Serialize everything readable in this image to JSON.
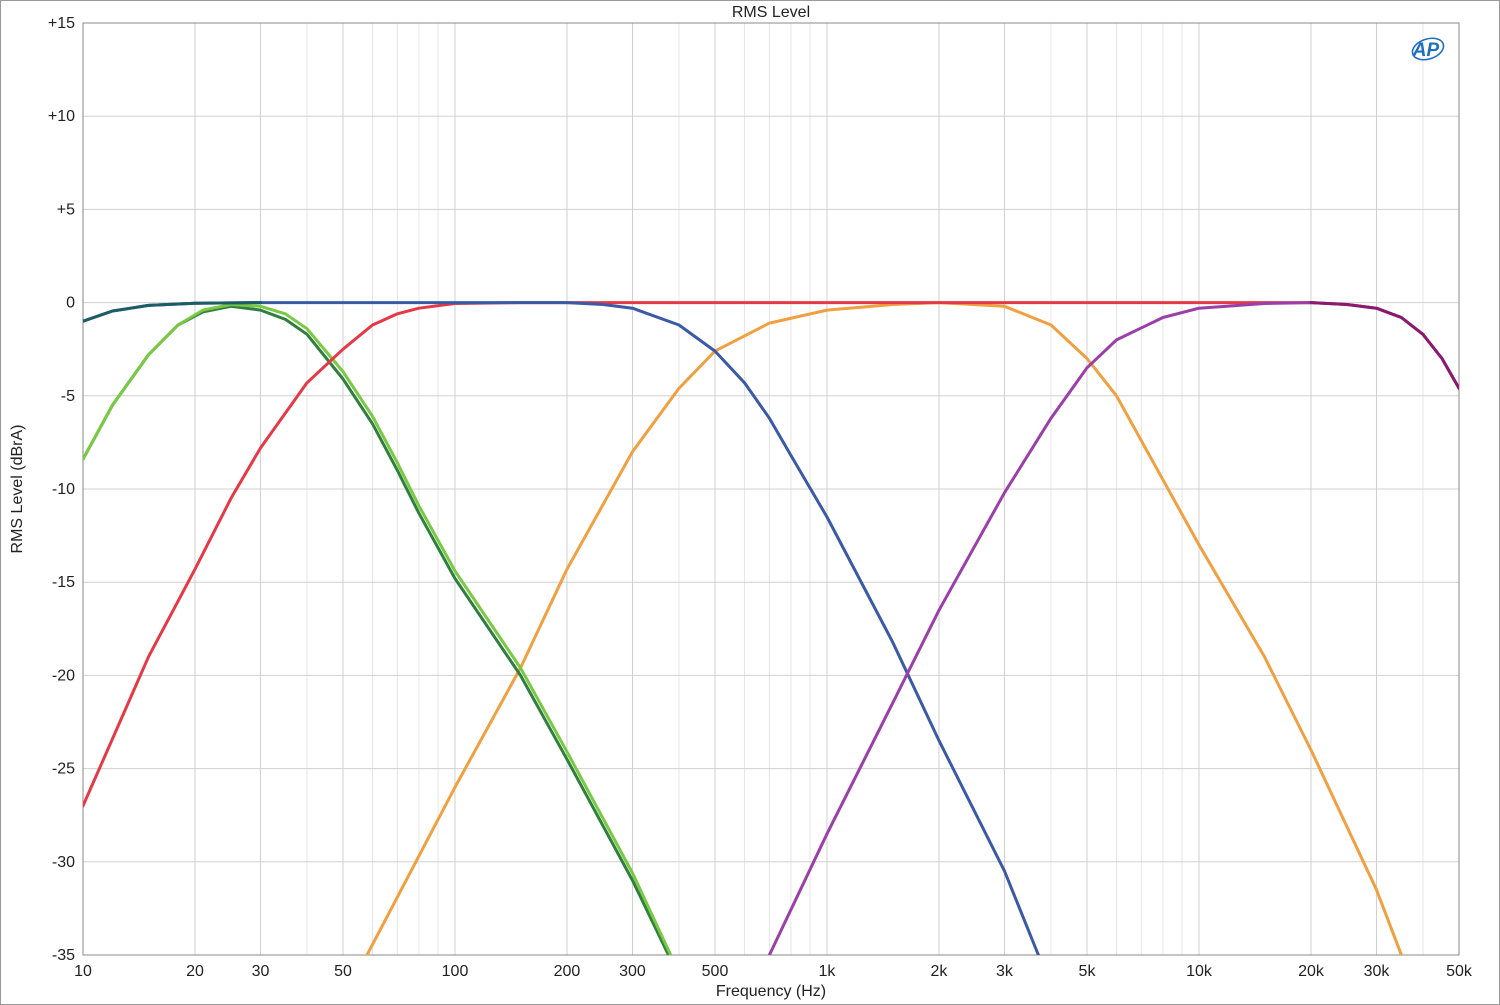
{
  "chart_data": {
    "type": "line",
    "title": "RMS Level",
    "xlabel": "Frequency (Hz)",
    "ylabel": "RMS Level (dBrA)",
    "xscale": "log",
    "xlim": [
      10,
      50000
    ],
    "ylim": [
      -35,
      15
    ],
    "x_ticks": [
      10,
      20,
      30,
      50,
      100,
      200,
      300,
      500,
      1000,
      2000,
      3000,
      5000,
      10000,
      20000,
      30000,
      50000
    ],
    "x_tick_labels": [
      "10",
      "20",
      "30",
      "50",
      "100",
      "200",
      "300",
      "500",
      "1k",
      "2k",
      "3k",
      "5k",
      "10k",
      "20k",
      "30k",
      "50k"
    ],
    "y_ticks": [
      15,
      10,
      5,
      0,
      -5,
      -10,
      -15,
      -20,
      -25,
      -30,
      -35
    ],
    "y_tick_labels": [
      "+15",
      "+10",
      "+5",
      "0",
      "-5",
      "-10",
      "-15",
      "-20",
      "-25",
      "-30",
      "-35"
    ],
    "grid": true,
    "logo": "AP",
    "series": [
      {
        "color": "#f0a040",
        "points": [
          [
            58,
            -35
          ],
          [
            100,
            -26
          ],
          [
            150,
            -19.6
          ],
          [
            200,
            -14.3
          ],
          [
            300,
            -8
          ],
          [
            400,
            -4.6
          ],
          [
            500,
            -2.6
          ],
          [
            700,
            -1.1
          ],
          [
            1000,
            -0.4
          ],
          [
            1500,
            -0.1
          ],
          [
            2000,
            0
          ],
          [
            3000,
            -0.2
          ],
          [
            4000,
            -1.2
          ],
          [
            5000,
            -3
          ],
          [
            6000,
            -5
          ],
          [
            8000,
            -9.5
          ],
          [
            10000,
            -13
          ],
          [
            15000,
            -19
          ],
          [
            20000,
            -24
          ],
          [
            30000,
            -31.5
          ],
          [
            35000,
            -35
          ]
        ]
      },
      {
        "color": "#2f7f3f",
        "points": [
          [
            10,
            -8.4
          ],
          [
            12,
            -5.5
          ],
          [
            15,
            -2.8
          ],
          [
            18,
            -1.2
          ],
          [
            21,
            -0.5
          ],
          [
            25,
            -0.2
          ],
          [
            30,
            -0.4
          ],
          [
            35,
            -0.9
          ],
          [
            40,
            -1.7
          ],
          [
            50,
            -4.1
          ],
          [
            60,
            -6.5
          ],
          [
            70,
            -9
          ],
          [
            80,
            -11.3
          ],
          [
            100,
            -14.8
          ],
          [
            150,
            -20
          ],
          [
            200,
            -24.5
          ],
          [
            300,
            -31
          ],
          [
            375,
            -35
          ]
        ]
      },
      {
        "color": "#7ac943",
        "points": [
          [
            10,
            -8.4
          ],
          [
            12,
            -5.5
          ],
          [
            15,
            -2.8
          ],
          [
            18,
            -1.2
          ],
          [
            21,
            -0.4
          ],
          [
            25,
            -0.1
          ],
          [
            30,
            -0.2
          ],
          [
            35,
            -0.6
          ],
          [
            40,
            -1.4
          ],
          [
            50,
            -3.7
          ],
          [
            60,
            -6.1
          ],
          [
            70,
            -8.6
          ],
          [
            80,
            -10.9
          ],
          [
            100,
            -14.4
          ],
          [
            150,
            -19.6
          ],
          [
            200,
            -24.1
          ],
          [
            300,
            -30.6
          ],
          [
            380,
            -35
          ]
        ]
      },
      {
        "color": "#e53945",
        "points": [
          [
            10,
            -27
          ],
          [
            15,
            -19
          ],
          [
            20,
            -14.3
          ],
          [
            25,
            -10.5
          ],
          [
            30,
            -7.8
          ],
          [
            40,
            -4.3
          ],
          [
            50,
            -2.5
          ],
          [
            60,
            -1.2
          ],
          [
            70,
            -0.6
          ],
          [
            80,
            -0.3
          ],
          [
            100,
            -0.05
          ],
          [
            150,
            0
          ],
          [
            1000,
            0
          ],
          [
            10000,
            0
          ],
          [
            20000,
            0
          ]
        ]
      },
      {
        "color": "#3a5aa6",
        "points": [
          [
            10,
            -1
          ],
          [
            12,
            -0.45
          ],
          [
            15,
            -0.15
          ],
          [
            20,
            -0.03
          ],
          [
            30,
            0
          ],
          [
            100,
            0
          ],
          [
            200,
            0
          ],
          [
            250,
            -0.1
          ],
          [
            300,
            -0.3
          ],
          [
            400,
            -1.2
          ],
          [
            500,
            -2.6
          ],
          [
            600,
            -4.3
          ],
          [
            700,
            -6.2
          ],
          [
            800,
            -8.2
          ],
          [
            1000,
            -11.5
          ],
          [
            1500,
            -18.2
          ],
          [
            2000,
            -23.5
          ],
          [
            3000,
            -30.5
          ],
          [
            3700,
            -35
          ]
        ]
      },
      {
        "color": "#1d5c66",
        "points": [
          [
            10,
            -1
          ],
          [
            12,
            -0.45
          ],
          [
            15,
            -0.15
          ],
          [
            20,
            -0.03
          ],
          [
            30,
            0
          ]
        ]
      },
      {
        "color": "#9b3fa8",
        "points": [
          [
            700,
            -35
          ],
          [
            1000,
            -28.5
          ],
          [
            1500,
            -21.5
          ],
          [
            2000,
            -16.5
          ],
          [
            3000,
            -10.2
          ],
          [
            4000,
            -6.2
          ],
          [
            5000,
            -3.5
          ],
          [
            6000,
            -2
          ],
          [
            8000,
            -0.8
          ],
          [
            10000,
            -0.3
          ],
          [
            15000,
            -0.05
          ],
          [
            20000,
            0
          ],
          [
            25000,
            -0.1
          ],
          [
            30000,
            -0.3
          ],
          [
            35000,
            -0.8
          ],
          [
            40000,
            -1.7
          ],
          [
            45000,
            -3
          ],
          [
            50000,
            -4.6
          ]
        ]
      },
      {
        "color": "#8b1a6e",
        "points": [
          [
            20000,
            0
          ],
          [
            25000,
            -0.1
          ],
          [
            30000,
            -0.3
          ],
          [
            35000,
            -0.8
          ],
          [
            40000,
            -1.7
          ],
          [
            45000,
            -3
          ],
          [
            50000,
            -4.6
          ]
        ]
      }
    ]
  }
}
